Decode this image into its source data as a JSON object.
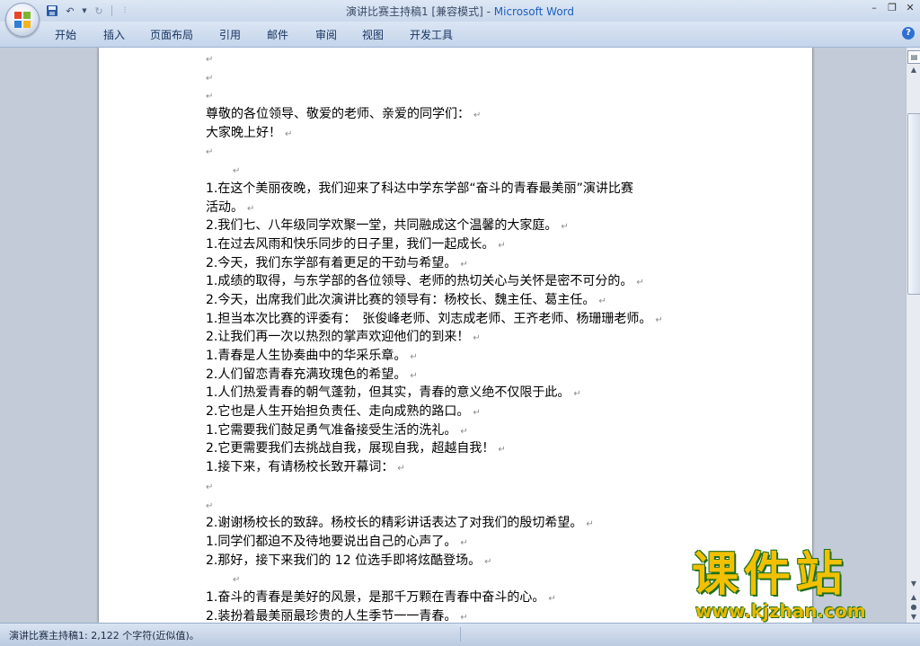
{
  "window": {
    "title": "演讲比赛主持稿1 [兼容模式] - ",
    "app_name": "Microsoft Word"
  },
  "quick_access": {
    "icons": [
      "save-icon",
      "undo-icon",
      "redo-icon",
      "customize-icon"
    ]
  },
  "ribbon": {
    "tabs": [
      "开始",
      "插入",
      "页面布局",
      "引用",
      "邮件",
      "审阅",
      "视图",
      "开发工具"
    ]
  },
  "document": {
    "paragraph_mark": "↵",
    "lines": [
      "",
      "",
      "",
      "尊敬的各位领导、敬爱的老师、亲爱的同学们：",
      "大家晚上好！",
      "",
      "",
      "1.在这个美丽夜晚，我们迎来了科达中学东学部“奋斗的青春最美丽”演讲比赛",
      "活动。",
      "2.我们七、八年级同学欢聚一堂，共同融成这个温馨的大家庭。",
      "1.在过去风雨和快乐同步的日子里，我们一起成长。",
      "2.今天，我们东学部有着更足的干劲与希望。",
      "1.成绩的取得，与东学部的各位领导、老师的热切关心与关怀是密不可分的。",
      "2.今天，出席我们此次演讲比赛的领导有：杨校长、魏主任、葛主任。",
      "1.担当本次比赛的评委有：　张俊峰老师、刘志成老师、王齐老师、杨珊珊老师。",
      "2.让我们再一次以热烈的掌声欢迎他们的到来！",
      "1.青春是人生协奏曲中的华采乐章。",
      "2.人们留恋青春充满玫瑰色的希望。",
      "1.人们热爱青春的朝气蓬勃，但其实，青春的意义绝不仅限于此。",
      "2.它也是人生开始担负责任、走向成熟的路口。",
      "1.它需要我们鼓足勇气准备接受生活的洗礼。",
      "2.它更需要我们去挑战自我，展现自我，超越自我！",
      "1.接下来，有请杨校长致开幕词：",
      "",
      "",
      "2.谢谢杨校长的致辞。杨校长的精彩讲话表达了对我们的殷切希望。",
      "1.同学们都迫不及待地要说出自己的心声了。",
      "2.那好，接下来我们的 12 位选手即将炫酷登场。",
      "",
      "1.奋斗的青春是美好的风景，是那千万颗在青春中奋斗的心。",
      "2.装扮着最美丽最珍贵的人生季节一一青春。"
    ],
    "indent_mark_lines": [
      6,
      28
    ]
  },
  "status_bar": {
    "text": "演讲比赛主持稿1: 2,122 个字符(近似值)。"
  },
  "watermark": {
    "main": "课件站",
    "url": "www.kjzhan.com"
  },
  "colors": {
    "title_app": "#1f5fbf",
    "watermark_fill": "#f2c000",
    "watermark_outline": "#1e6f1e"
  }
}
